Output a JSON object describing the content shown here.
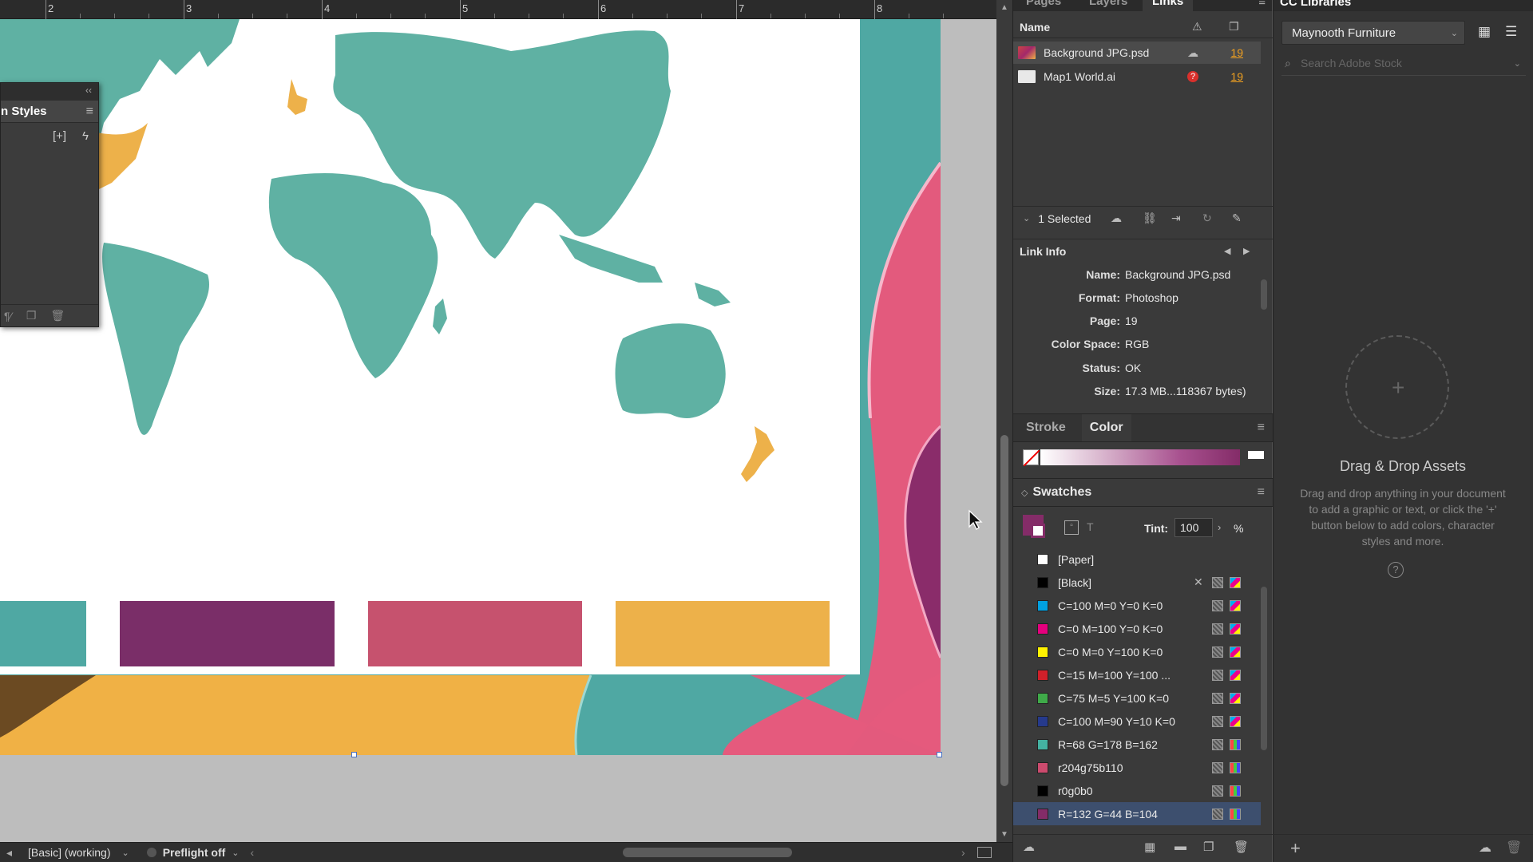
{
  "ruler": {
    "numbers": [
      "2",
      "3",
      "4",
      "5",
      "6",
      "7",
      "8"
    ]
  },
  "styles_panel": {
    "title": "n Styles"
  },
  "status_bar": {
    "workspace": "[Basic] (working)",
    "preflight": "Preflight off"
  },
  "links_panel": {
    "tabs": [
      "Pages",
      "Layers",
      "Links"
    ],
    "active_tab": "Links",
    "column_name": "Name",
    "items": [
      {
        "name": "Background JPG.psd",
        "page": "19"
      },
      {
        "name": "Map1 World.ai",
        "page": "19"
      }
    ],
    "selected_count": "1 Selected"
  },
  "link_info": {
    "title": "Link Info",
    "fields": [
      {
        "key": "Name:",
        "value": "Background JPG.psd"
      },
      {
        "key": "Format:",
        "value": "Photoshop"
      },
      {
        "key": "Page:",
        "value": "19"
      },
      {
        "key": "Color Space:",
        "value": "RGB"
      },
      {
        "key": "Status:",
        "value": "OK"
      },
      {
        "key": "Size:",
        "value": "17.3 MB...118367 bytes)"
      }
    ]
  },
  "stroke_color": {
    "tabs": [
      "Stroke",
      "Color"
    ],
    "active": "Color"
  },
  "swatches": {
    "title": "Swatches",
    "tint_label": "Tint:",
    "tint_value": "100",
    "percent": "%",
    "items": [
      {
        "name": "[Paper]",
        "color": "#ffffff"
      },
      {
        "name": "[Black]",
        "color": "#000000"
      },
      {
        "name": "C=100 M=0 Y=0 K=0",
        "color": "#00a0e0"
      },
      {
        "name": "C=0 M=100 Y=0 K=0",
        "color": "#e5007e"
      },
      {
        "name": "C=0 M=0 Y=100 K=0",
        "color": "#fff200"
      },
      {
        "name": "C=15 M=100 Y=100 ...",
        "color": "#d0202a"
      },
      {
        "name": "C=75 M=5 Y=100 K=0",
        "color": "#3faa49"
      },
      {
        "name": "C=100 M=90 Y=10 K=0",
        "color": "#263a8c"
      },
      {
        "name": "R=68 G=178 B=162",
        "color": "#44b2a2"
      },
      {
        "name": "r204g75b110",
        "color": "#cc4b6e"
      },
      {
        "name": "r0g0b0",
        "color": "#000000"
      },
      {
        "name": "R=132 G=44 B=104",
        "color": "#842c68"
      }
    ],
    "selected_index": 11
  },
  "cc_libraries": {
    "title": "CC Libraries",
    "library": "Maynooth Furniture",
    "search_placeholder": "Search Adobe Stock",
    "dropzone_title": "Drag & Drop Assets",
    "dropzone_text": "Drag and drop anything in your document to add a graphic or text, or click the '+' button below to add colors, character styles and more."
  },
  "colors": {
    "teal": "#4fa8a3",
    "map_teal": "#5fb1a3",
    "purple": "#7a2e68",
    "pink": "#c6526e",
    "orange": "#edb14a",
    "accent_orange": "#f0a020",
    "selection_blue": "#3d4f6e"
  }
}
